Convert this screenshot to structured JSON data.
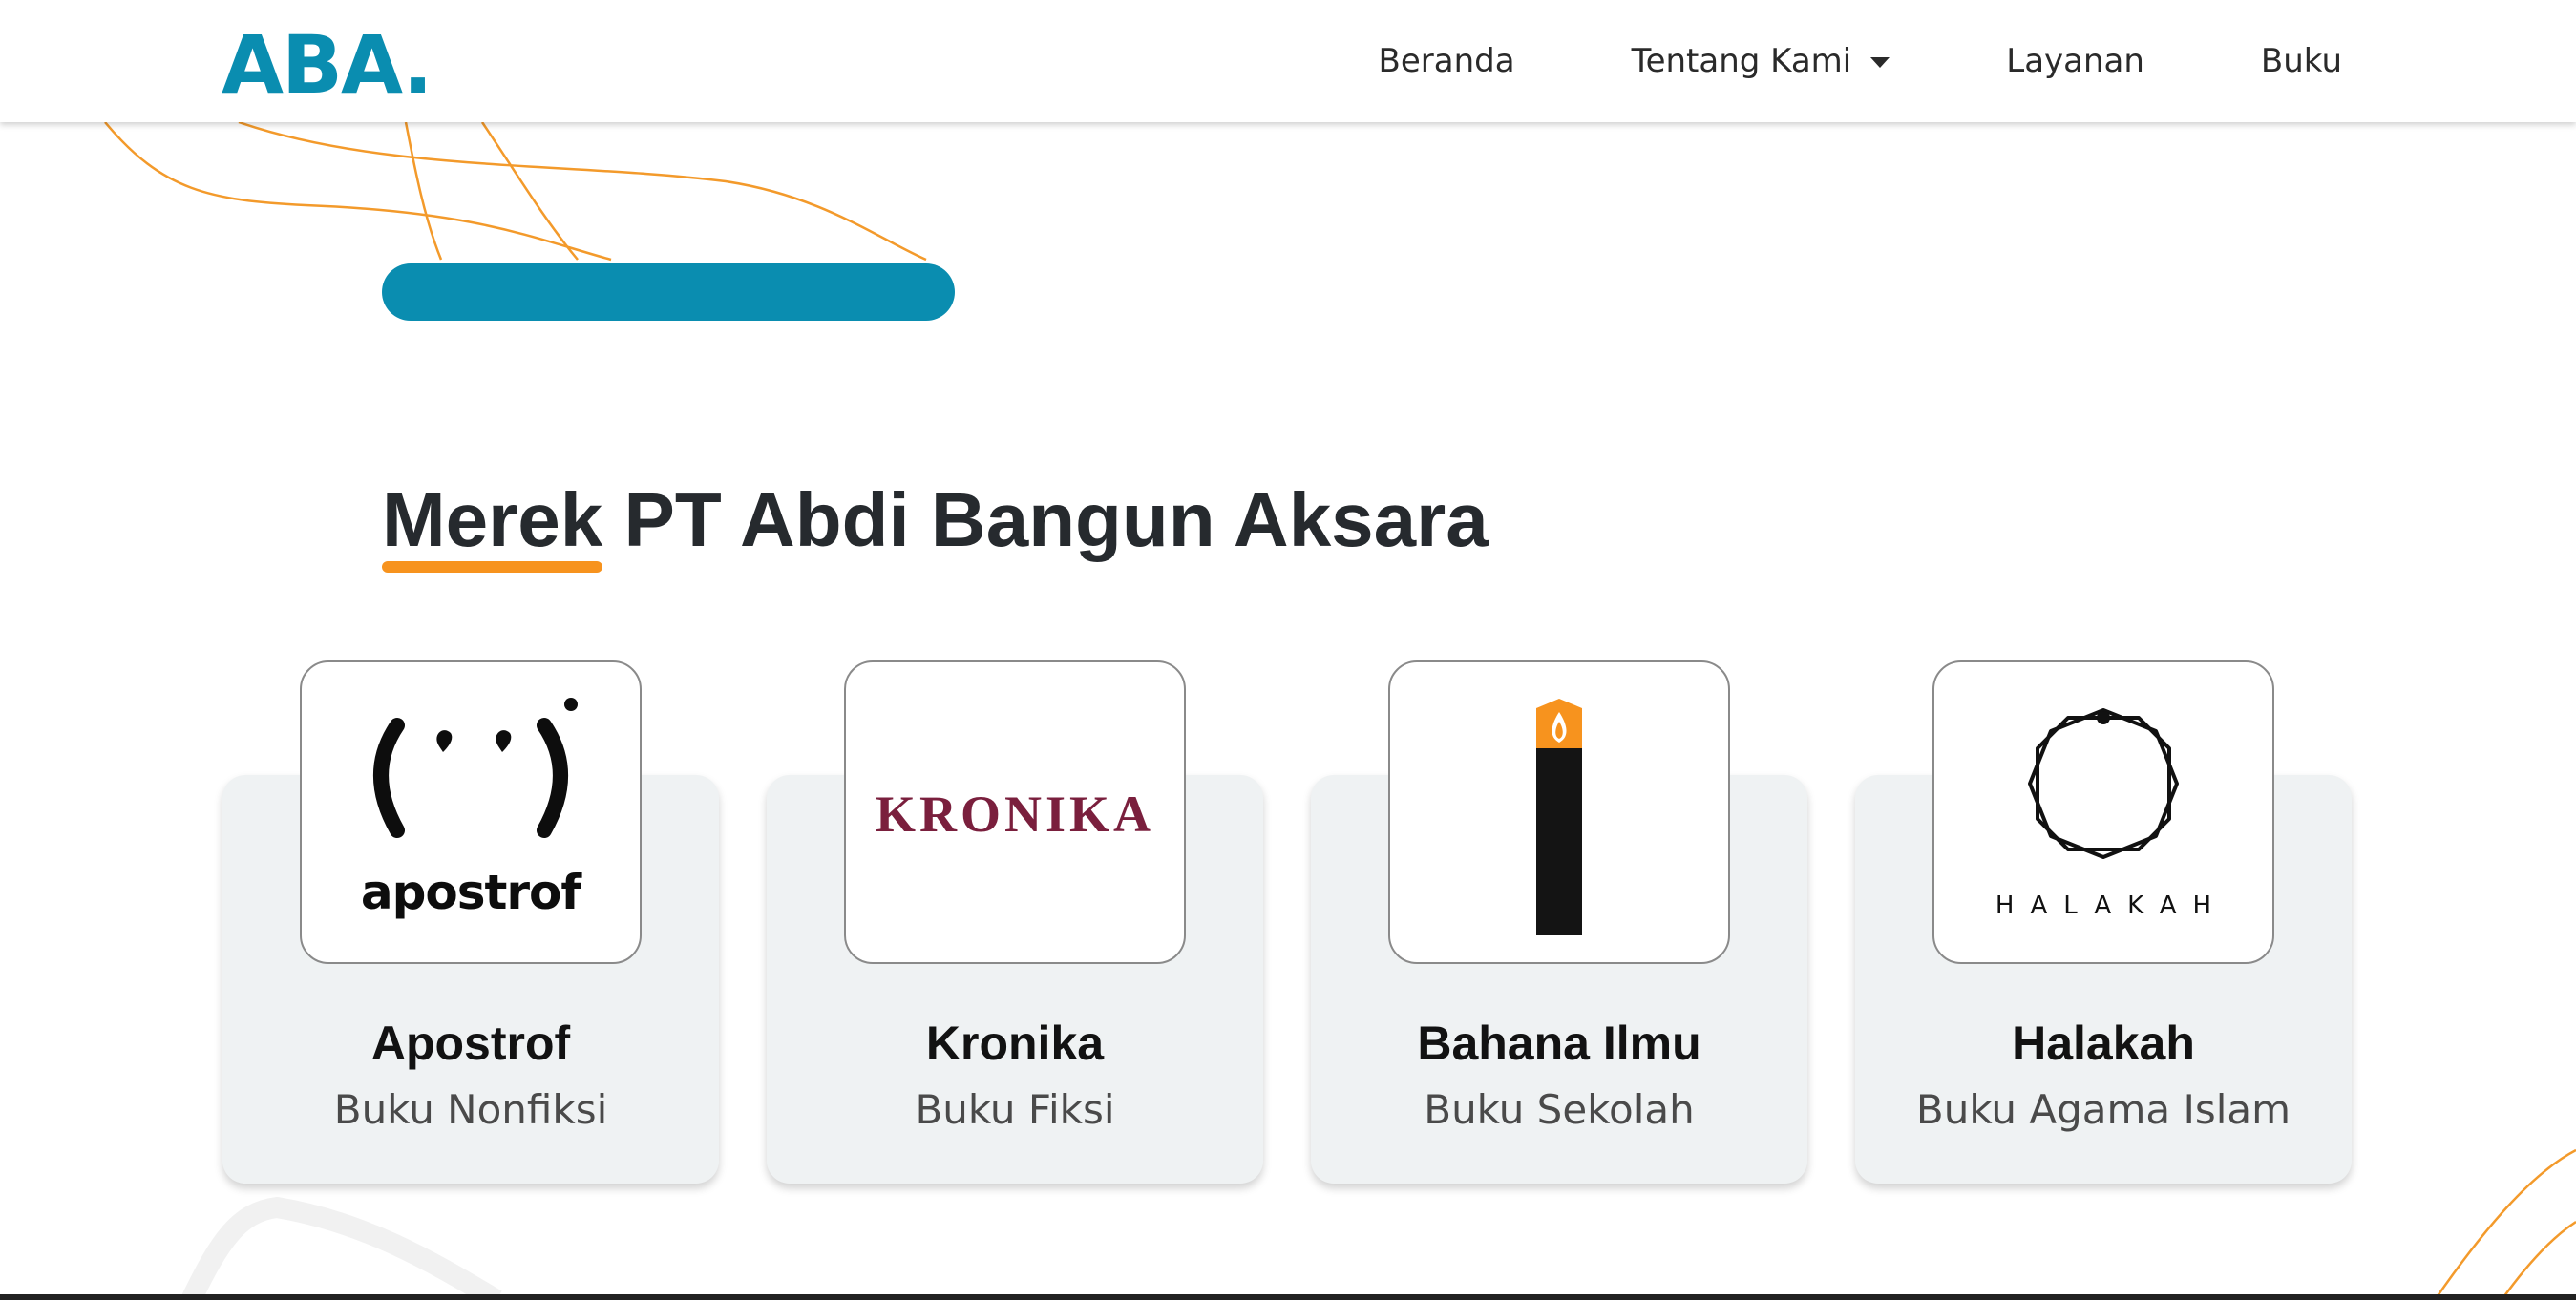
{
  "navbar": {
    "logo": "ABA.",
    "links": [
      "Beranda",
      "Tentang Kami",
      "Layanan",
      "Buku"
    ]
  },
  "section": {
    "title_highlight": "Merek",
    "title_rest": " PT Abdi Bangun Aksara"
  },
  "brands": [
    {
      "name": "Apostrof",
      "category": "Buku Nonfiksi",
      "logo_text": "apostrof",
      "icon": "apostrof-face-icon"
    },
    {
      "name": "Kronika",
      "category": "Buku Fiksi",
      "logo_text": "KRONIKA",
      "icon": "kronika-wordmark"
    },
    {
      "name": "Bahana Ilmu",
      "category": "Buku Sekolah",
      "logo_text": "",
      "icon": "candle-icon"
    },
    {
      "name": "Halakah",
      "category": "Buku Agama Islam",
      "logo_text": "HALAKAH",
      "icon": "star-ring-icon"
    }
  ],
  "colors": {
    "brand": "#0a8db0",
    "accent": "#f7931e",
    "card_bg": "#eff2f3",
    "kronika": "#7a1f3d"
  }
}
